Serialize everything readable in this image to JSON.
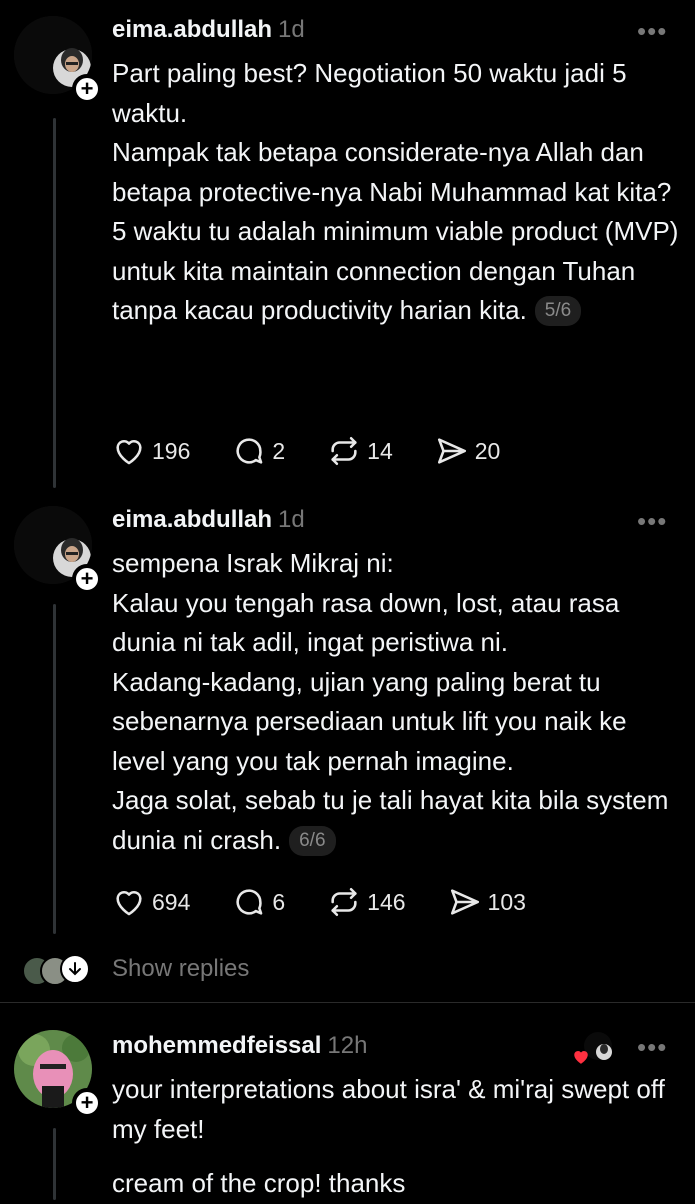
{
  "posts": [
    {
      "username": "eima.abdullah",
      "time": "1d",
      "text": "Part paling best? Negotiation 50 waktu jadi 5 waktu.\nNampak tak betapa considerate-nya Allah dan betapa protective-nya Nabi Muhammad kat kita?\n5 waktu tu adalah minimum viable product (MVP) untuk kita maintain connection dengan Tuhan tanpa kacau productivity harian kita.",
      "counter": "5/6",
      "likes": "196",
      "replies": "2",
      "reposts": "14",
      "shares": "20"
    },
    {
      "username": "eima.abdullah",
      "time": "1d",
      "text": "sempena Israk Mikraj ni:\nKalau you tengah rasa down, lost, atau rasa dunia ni tak adil, ingat peristiwa ni.\nKadang-kadang, ujian yang paling berat tu sebenarnya persediaan untuk lift you naik ke level yang you tak pernah imagine.\nJaga solat, sebab tu je tali hayat kita bila system dunia ni crash.",
      "counter": "6/6",
      "likes": "694",
      "replies": "6",
      "reposts": "146",
      "shares": "103"
    }
  ],
  "show_replies": "Show replies",
  "reply": {
    "username": "mohemmedfeissal",
    "time": "12h",
    "text": "your interpretations about isra' & mi'raj swept off my feet!",
    "text2": "cream of the crop! thanks"
  },
  "icons": {
    "more": "more-horizontal-icon",
    "like": "heart-icon",
    "reply": "comment-icon",
    "repost": "repost-icon",
    "share": "send-icon"
  },
  "colors": {
    "background": "#000000",
    "text": "#f3f5f7",
    "muted": "#777777",
    "like_badge": "#ff3040"
  }
}
